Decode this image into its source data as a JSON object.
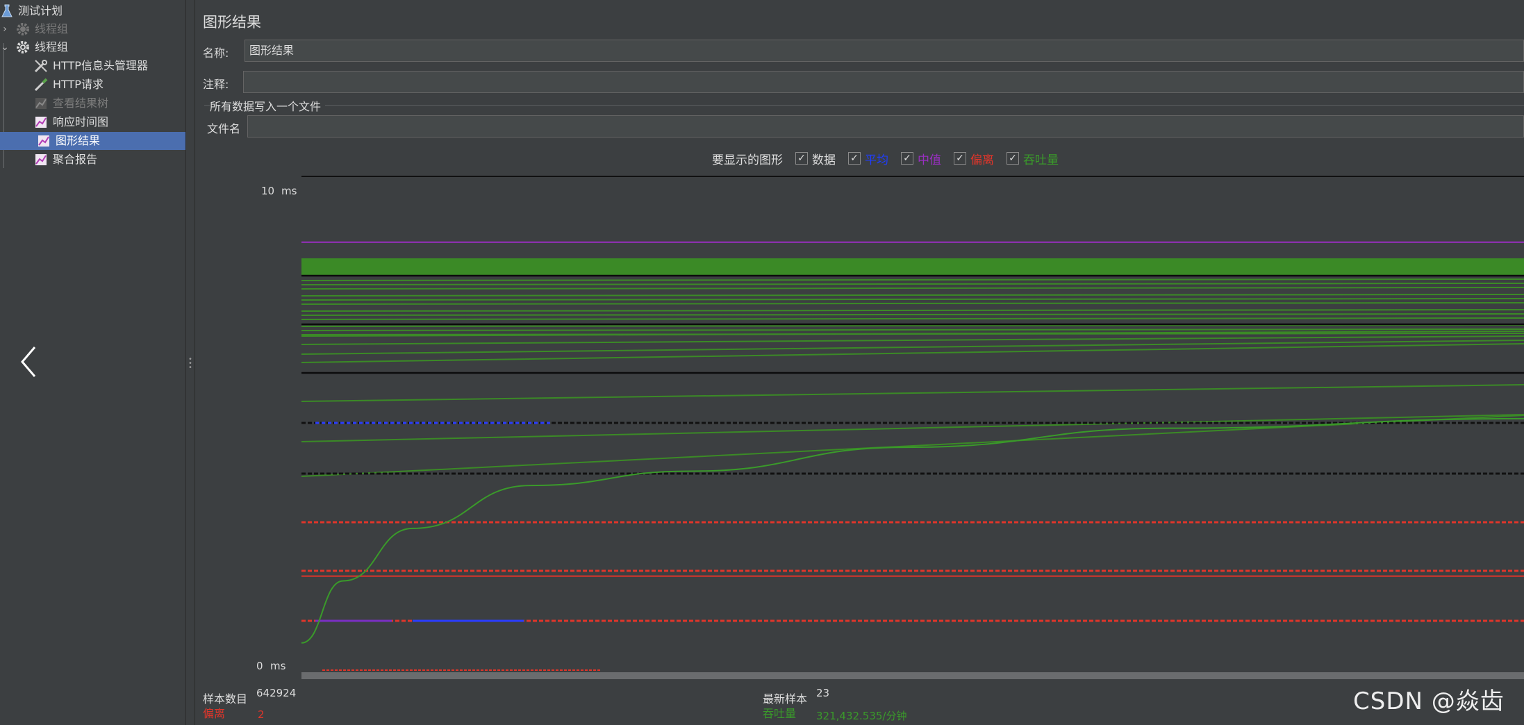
{
  "tree": {
    "items": [
      {
        "label": "测试计划",
        "icon": "flask-icon",
        "dim": false,
        "selected": false
      },
      {
        "label": "线程组",
        "icon": "gear-icon",
        "dim": true,
        "selected": false
      },
      {
        "label": "线程组",
        "icon": "gear-icon",
        "dim": false,
        "selected": false
      },
      {
        "label": "HTTP信息头管理器",
        "icon": "wrench-icon",
        "dim": false,
        "selected": false
      },
      {
        "label": "HTTP请求",
        "icon": "pipette-icon",
        "dim": false,
        "selected": false
      },
      {
        "label": "查看结果树",
        "icon": "chart-icon",
        "dim": true,
        "selected": false
      },
      {
        "label": "响应时间图",
        "icon": "chart-icon",
        "dim": false,
        "selected": false
      },
      {
        "label": "图形结果",
        "icon": "chart-icon",
        "dim": false,
        "selected": true
      },
      {
        "label": "聚合报告",
        "icon": "chart-icon",
        "dim": false,
        "selected": false
      }
    ]
  },
  "panel": {
    "title": "图形结果",
    "name_label": "名称:",
    "name_value": "图形结果",
    "comment_label": "注释:",
    "comment_value": "",
    "write_all_label": "所有数据写入一个文件",
    "filename_label": "文件名",
    "filename_value": ""
  },
  "graph_options": {
    "title": "要显示的图形",
    "items": [
      {
        "label": "数据",
        "checked": true,
        "color": "#dddddd"
      },
      {
        "label": "平均",
        "checked": true,
        "color": "#1f3dff"
      },
      {
        "label": "中值",
        "checked": true,
        "color": "#9a2fc2"
      },
      {
        "label": "偏离",
        "checked": true,
        "color": "#e0352a"
      },
      {
        "label": "吞吐量",
        "checked": true,
        "color": "#3a9a2a"
      }
    ]
  },
  "chart_data": {
    "type": "line",
    "y_max_label": "10",
    "y_min_label": "0",
    "y_unit": "ms",
    "ylim": [
      0,
      10
    ],
    "series": [
      {
        "name": "中值",
        "color": "#9a2fc2",
        "values": [
          9.0,
          9.0
        ]
      },
      {
        "name": "偏离",
        "color": "#e0352a",
        "values": [
          2.0,
          2.0
        ]
      },
      {
        "name": "吞吐量",
        "color": "#3a9a2a",
        "values": [
          0.6,
          1.9,
          3.0,
          3.9,
          4.2,
          4.7,
          5.1,
          5.3
        ]
      }
    ]
  },
  "footer": {
    "samples_label": "样本数目",
    "samples_value": "642924",
    "deviation_label": "偏离",
    "deviation_value": "2",
    "latest_label": "最新样本",
    "latest_value": "23",
    "throughput_label": "吞吐量",
    "throughput_value": "321,432.535/分钟"
  },
  "watermark": "CSDN @焱齿"
}
